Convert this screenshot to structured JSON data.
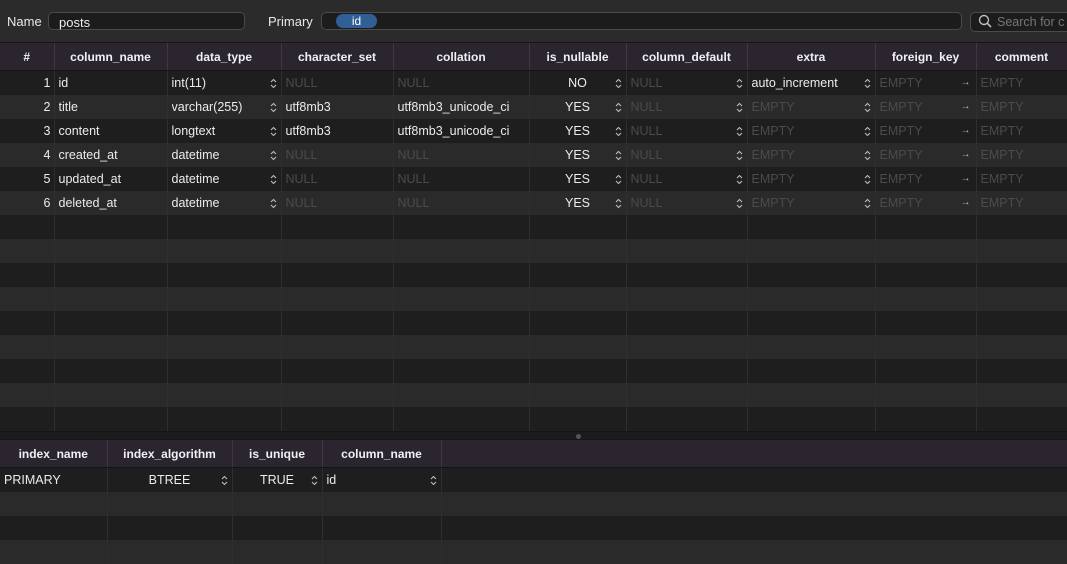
{
  "toolbar": {
    "name_label": "Name",
    "name_value": "posts",
    "primary_label": "Primary",
    "primary_token": "id",
    "search_placeholder": "Search for c"
  },
  "columns_table": {
    "headers": [
      "#",
      "column_name",
      "data_type",
      "character_set",
      "collation",
      "is_nullable",
      "column_default",
      "extra",
      "foreign_key",
      "comment"
    ],
    "rows": [
      {
        "num": "1",
        "column_name": "id",
        "data_type": "int(11)",
        "character_set": "NULL",
        "collation": "NULL",
        "is_nullable": "NO",
        "column_default": "NULL",
        "extra": "auto_increment",
        "foreign_key": "EMPTY",
        "comment": "EMPTY"
      },
      {
        "num": "2",
        "column_name": "title",
        "data_type": "varchar(255)",
        "character_set": "utf8mb3",
        "collation": "utf8mb3_unicode_ci",
        "is_nullable": "YES",
        "column_default": "NULL",
        "extra": "EMPTY",
        "foreign_key": "EMPTY",
        "comment": "EMPTY"
      },
      {
        "num": "3",
        "column_name": "content",
        "data_type": "longtext",
        "character_set": "utf8mb3",
        "collation": "utf8mb3_unicode_ci",
        "is_nullable": "YES",
        "column_default": "NULL",
        "extra": "EMPTY",
        "foreign_key": "EMPTY",
        "comment": "EMPTY"
      },
      {
        "num": "4",
        "column_name": "created_at",
        "data_type": "datetime",
        "character_set": "NULL",
        "collation": "NULL",
        "is_nullable": "YES",
        "column_default": "NULL",
        "extra": "EMPTY",
        "foreign_key": "EMPTY",
        "comment": "EMPTY"
      },
      {
        "num": "5",
        "column_name": "updated_at",
        "data_type": "datetime",
        "character_set": "NULL",
        "collation": "NULL",
        "is_nullable": "YES",
        "column_default": "NULL",
        "extra": "EMPTY",
        "foreign_key": "EMPTY",
        "comment": "EMPTY"
      },
      {
        "num": "6",
        "column_name": "deleted_at",
        "data_type": "datetime",
        "character_set": "NULL",
        "collation": "NULL",
        "is_nullable": "YES",
        "column_default": "NULL",
        "extra": "EMPTY",
        "foreign_key": "EMPTY",
        "comment": "EMPTY"
      }
    ]
  },
  "indexes_table": {
    "headers": [
      "index_name",
      "index_algorithm",
      "is_unique",
      "column_name"
    ],
    "rows": [
      {
        "index_name": "PRIMARY",
        "index_algorithm": "BTREE",
        "is_unique": "TRUE",
        "column_name": "id"
      }
    ]
  },
  "colors": {
    "header_bg": "#2b2530",
    "token_bg": "#2f5f95",
    "row_odd": "#1e1e1e",
    "row_even": "#2a2a2a",
    "placeholder_text": "#4b4b4b"
  },
  "icons": [
    "search-icon",
    "stepper-icon",
    "arrow-right-icon"
  ]
}
